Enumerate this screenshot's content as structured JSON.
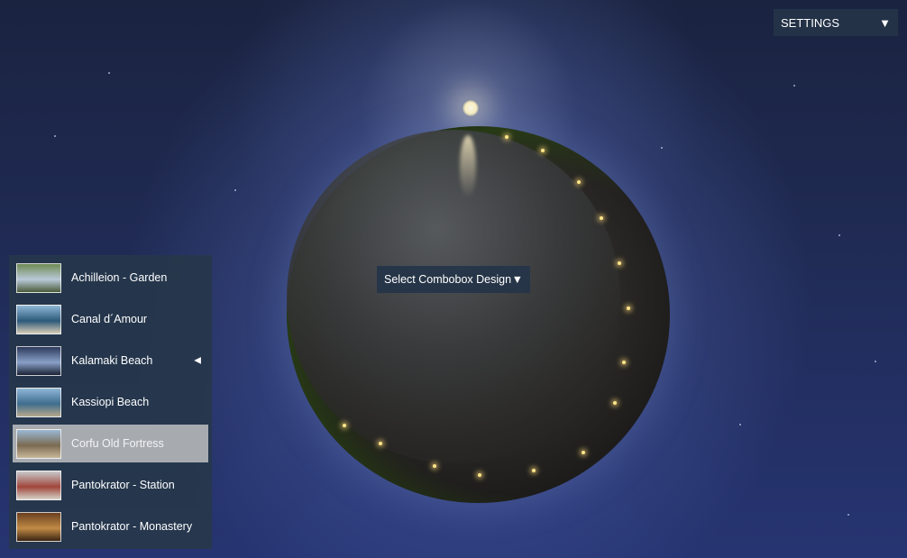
{
  "settings": {
    "label": "SETTINGS",
    "arrow": "▼"
  },
  "combobox": {
    "label": "Select Combobox Design",
    "arrow": "▼"
  },
  "panoramas": {
    "active_marker": "◀",
    "items": [
      {
        "label": "Achilleion - Garden",
        "thumb_colors": [
          "#6f8a55",
          "#b9c9d8",
          "#4a5a3a"
        ]
      },
      {
        "label": "Canal d´Amour",
        "thumb_colors": [
          "#8fb7d6",
          "#2d5a7a",
          "#d9cdb6"
        ]
      },
      {
        "label": "Kalamaki Beach",
        "thumb_colors": [
          "#2c3a5c",
          "#8aa0c8",
          "#1a2233"
        ]
      },
      {
        "label": "Kassiopi Beach",
        "thumb_colors": [
          "#8fb6d8",
          "#3e6d8d",
          "#b7a88c"
        ]
      },
      {
        "label": "Corfu Old Fortress",
        "thumb_colors": [
          "#9bb9d5",
          "#7a6a52",
          "#c9b89a"
        ]
      },
      {
        "label": "Pantokrator - Station",
        "thumb_colors": [
          "#c8c9cc",
          "#a0463c",
          "#d6d2c8"
        ]
      },
      {
        "label": "Pantokrator - Monastery",
        "thumb_colors": [
          "#6a4020",
          "#c08a45",
          "#3a2412"
        ]
      }
    ],
    "active_index": 2,
    "selected_index": 4
  },
  "colors": {
    "panel_bg": "#26374b",
    "selected_bg": "#a7abb0",
    "sky_top": "#1a2340",
    "sky_bottom": "#263472"
  }
}
